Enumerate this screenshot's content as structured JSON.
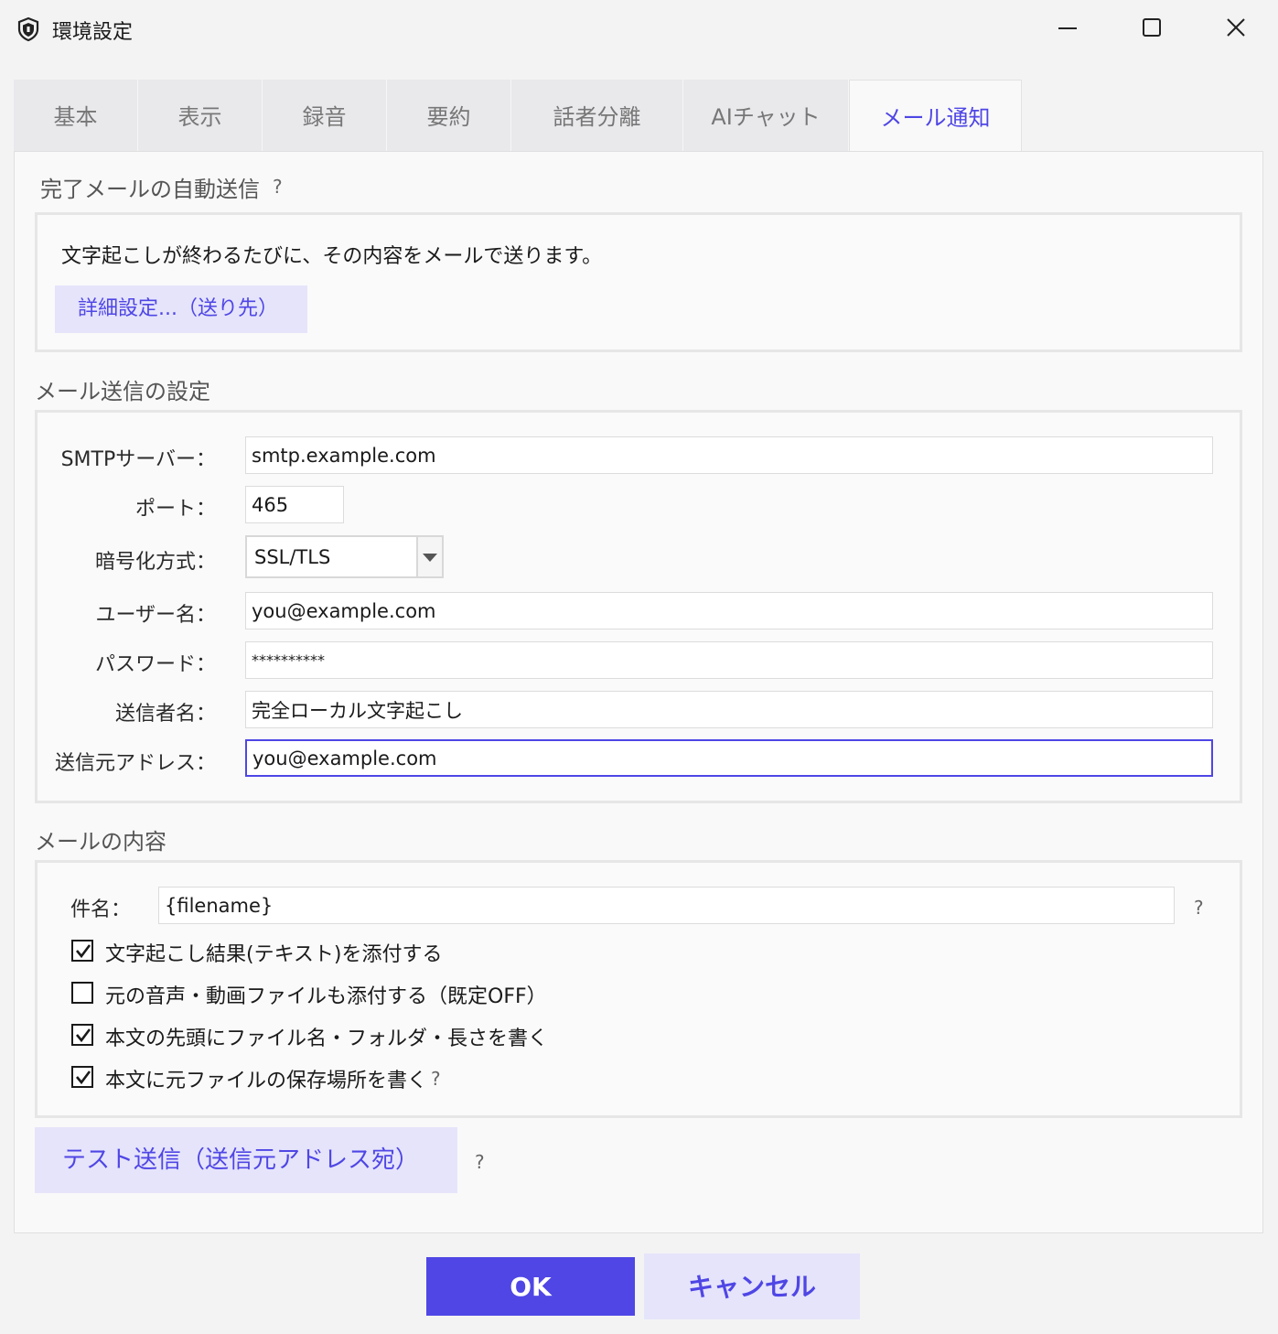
{
  "window": {
    "title": "環境設定",
    "icon": "shield-icon"
  },
  "tabs": [
    {
      "label": "基本",
      "active": false
    },
    {
      "label": "表示",
      "active": false
    },
    {
      "label": "録音",
      "active": false
    },
    {
      "label": "要約",
      "active": false
    },
    {
      "label": "話者分離",
      "active": false
    },
    {
      "label": "AIチャット",
      "active": false
    },
    {
      "label": "メール通知",
      "active": true
    }
  ],
  "auto_send": {
    "title": "完了メールの自動送信",
    "help": "?",
    "description": "文字起こしが終わるたびに、その内容をメールで送ります。",
    "detail_button": "詳細設定...（送り先）"
  },
  "smtp": {
    "title": "メール送信の設定",
    "server_label": "SMTPサーバー：",
    "server_value": "smtp.example.com",
    "port_label": "ポート：",
    "port_value": "465",
    "encryption_label": "暗号化方式：",
    "encryption_value": "SSL/TLS",
    "username_label": "ユーザー名：",
    "username_value": "you@example.com",
    "password_label": "パスワード：",
    "password_value": "**********",
    "sender_name_label": "送信者名：",
    "sender_name_value": "完全ローカル文字起こし",
    "sender_address_label": "送信元アドレス：",
    "sender_address_value": "you@example.com"
  },
  "content": {
    "title": "メールの内容",
    "subject_label": "件名：",
    "subject_value": "{filename}",
    "subject_help": "?",
    "options": [
      {
        "label": "文字起こし結果(テキスト)を添付する",
        "checked": true,
        "help": ""
      },
      {
        "label": "元の音声・動画ファイルも添付する（既定OFF）",
        "checked": false,
        "help": ""
      },
      {
        "label": "本文の先頭にファイル名・フォルダ・長さを書く",
        "checked": true,
        "help": "?"
      },
      {
        "label": "本文に元ファイルの保存場所を書く",
        "checked": true,
        "help": "?"
      }
    ]
  },
  "test_button": "テスト送信（送信元アドレス宛）",
  "test_help": "?",
  "footer": {
    "ok": "OK",
    "cancel": "キャンセル"
  },
  "colors": {
    "accent": "#4f46e5",
    "accent_light": "#e5e4fb",
    "background": "#f3f3f3"
  }
}
